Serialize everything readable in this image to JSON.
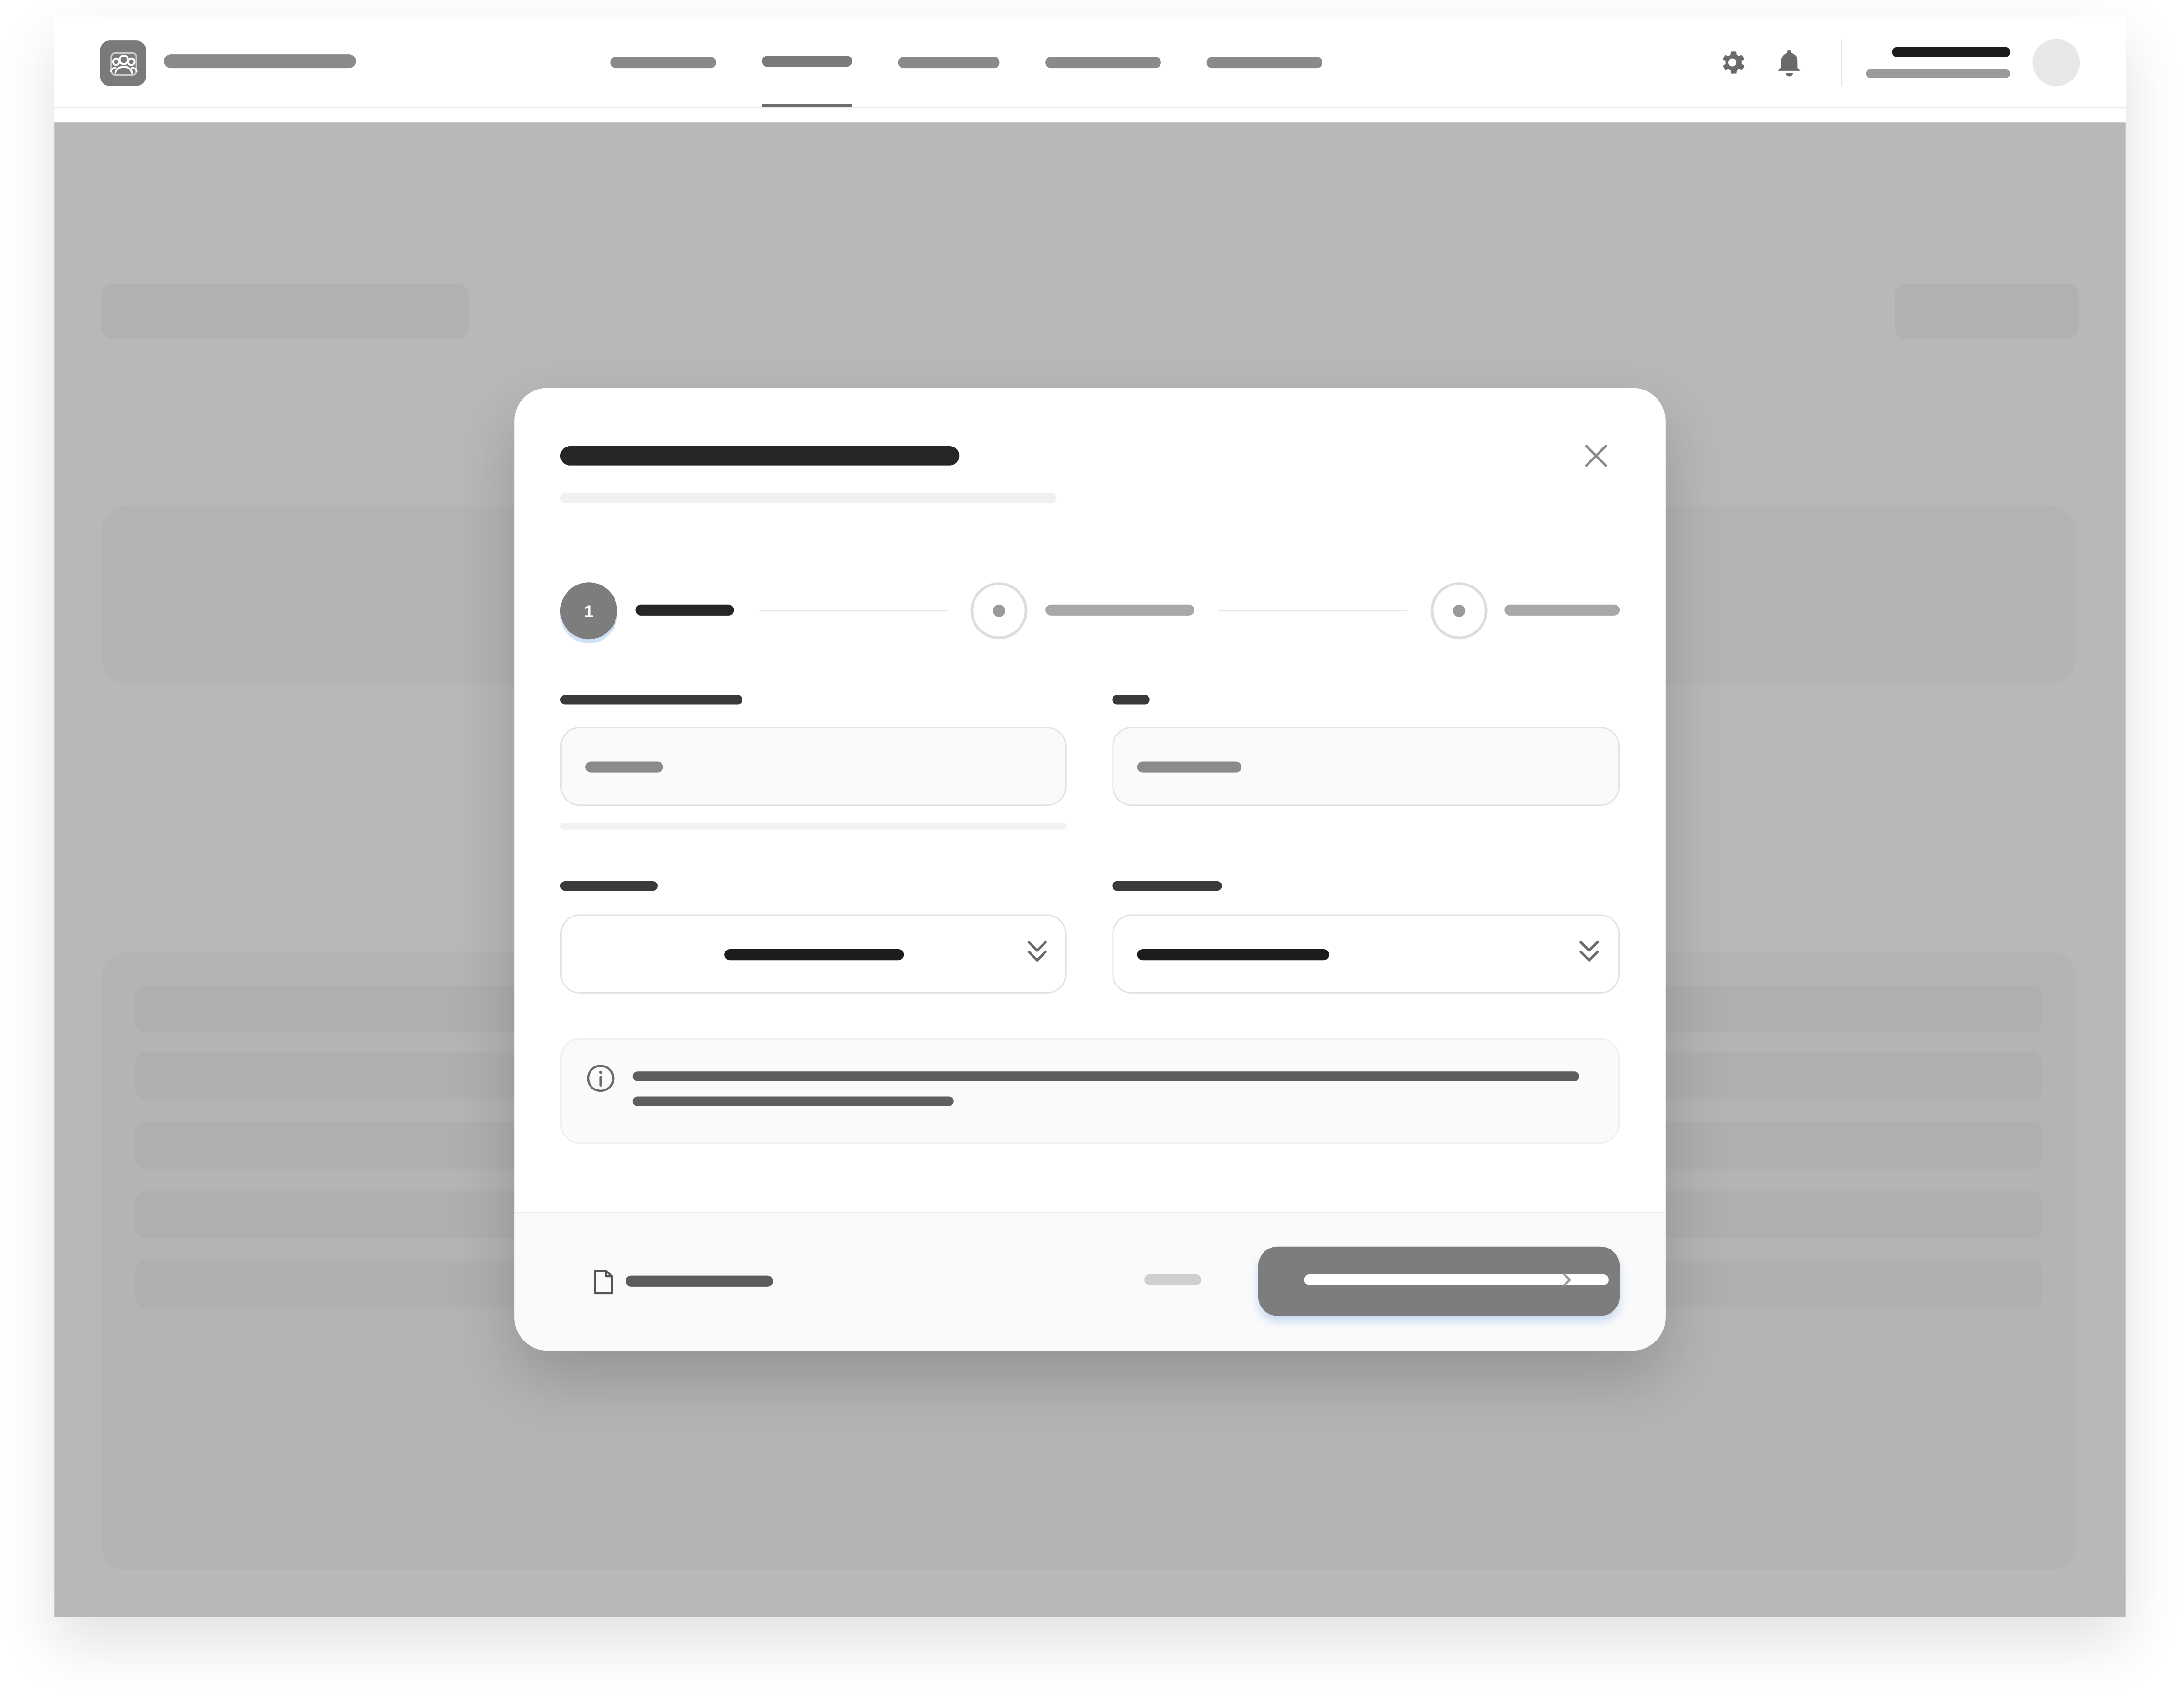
{
  "app": {
    "brand_name": "",
    "icons": {
      "logo": "team-icon",
      "settings": "gear-icon",
      "notifications": "bell-icon"
    }
  },
  "nav": {
    "items": [
      {
        "label": "",
        "active": false
      },
      {
        "label": "",
        "active": true
      },
      {
        "label": "",
        "active": false
      },
      {
        "label": "",
        "active": false
      },
      {
        "label": "",
        "active": false
      }
    ]
  },
  "user": {
    "name": "",
    "role": ""
  },
  "background": {
    "page_title": "",
    "action_label": ""
  },
  "modal": {
    "title": "",
    "subtitle": "",
    "close_icon": "close-icon",
    "steps": [
      {
        "number": "1",
        "label": "",
        "state": "active"
      },
      {
        "label": "",
        "state": "upcoming"
      },
      {
        "label": "",
        "state": "upcoming"
      }
    ],
    "fields": {
      "field_1": {
        "label": "",
        "value": "",
        "placeholder": "",
        "helper": ""
      },
      "field_2": {
        "label": "",
        "value": "",
        "placeholder": ""
      },
      "select_1": {
        "label": "",
        "selected": ""
      },
      "select_2": {
        "label": "",
        "selected": ""
      }
    },
    "info": {
      "icon": "info-icon",
      "line1": "",
      "line2": ""
    },
    "footer": {
      "doc_link": "",
      "doc_icon": "document-icon",
      "back_label": "",
      "primary_label": "",
      "primary_icon": "arrow-right-icon"
    }
  },
  "colors": {
    "primary": "#7d7d7d",
    "text_dark": "#1c1c1c",
    "backdrop": "#b8b8b8",
    "focus_ring": "#cfe0f7"
  }
}
